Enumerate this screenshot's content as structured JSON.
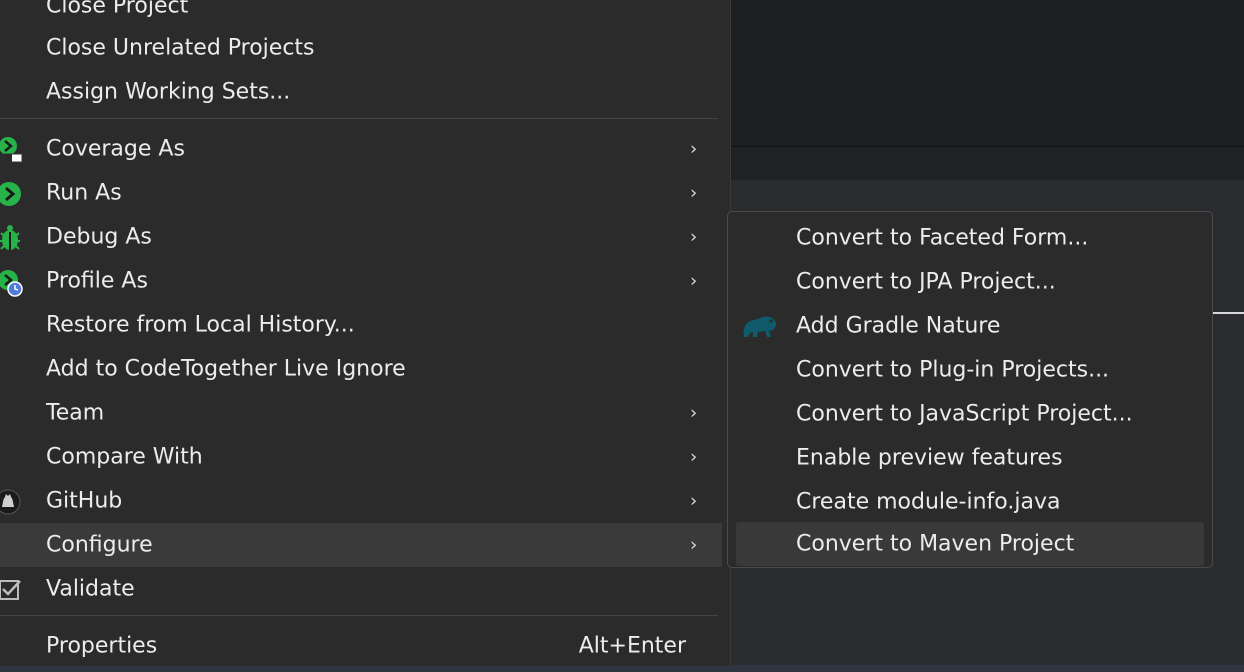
{
  "context_menu": {
    "items": [
      {
        "label": "Close Project"
      },
      {
        "label": "Close Unrelated Projects"
      },
      {
        "label": "Assign Working Sets..."
      },
      {
        "label": "Coverage As",
        "submenu": true,
        "icon": "coverage-icon"
      },
      {
        "label": "Run As",
        "submenu": true,
        "icon": "run-icon"
      },
      {
        "label": "Debug As",
        "submenu": true,
        "icon": "debug-bug-icon"
      },
      {
        "label": "Profile As",
        "submenu": true,
        "icon": "profile-icon"
      },
      {
        "label": "Restore from Local History..."
      },
      {
        "label": "Add to CodeTogether Live Ignore"
      },
      {
        "label": "Team",
        "submenu": true
      },
      {
        "label": "Compare With",
        "submenu": true
      },
      {
        "label": "GitHub",
        "submenu": true,
        "icon": "github-icon"
      },
      {
        "label": "Configure",
        "submenu": true,
        "selected": true
      },
      {
        "label": "Validate",
        "icon": "validate-check-icon"
      },
      {
        "label": "Properties",
        "shortcut": "Alt+Enter"
      }
    ],
    "submenu_arrow": "›"
  },
  "configure_submenu": {
    "items": [
      {
        "label": "Convert to Faceted Form..."
      },
      {
        "label": "Convert to JPA Project..."
      },
      {
        "label": "Add Gradle Nature",
        "icon": "gradle-elephant-icon"
      },
      {
        "label": "Convert to Plug-in Projects..."
      },
      {
        "label": "Convert to JavaScript Project..."
      },
      {
        "label": "Enable preview features"
      },
      {
        "label": "Create module-info.java"
      },
      {
        "label": "Convert to Maven Project",
        "selected": true
      }
    ]
  },
  "colors": {
    "menu_bg": "#2b2b2b",
    "selected_bg": "#3a3a3a",
    "run_green": "#27b34a",
    "gradle_teal": "#0f5a6b"
  }
}
